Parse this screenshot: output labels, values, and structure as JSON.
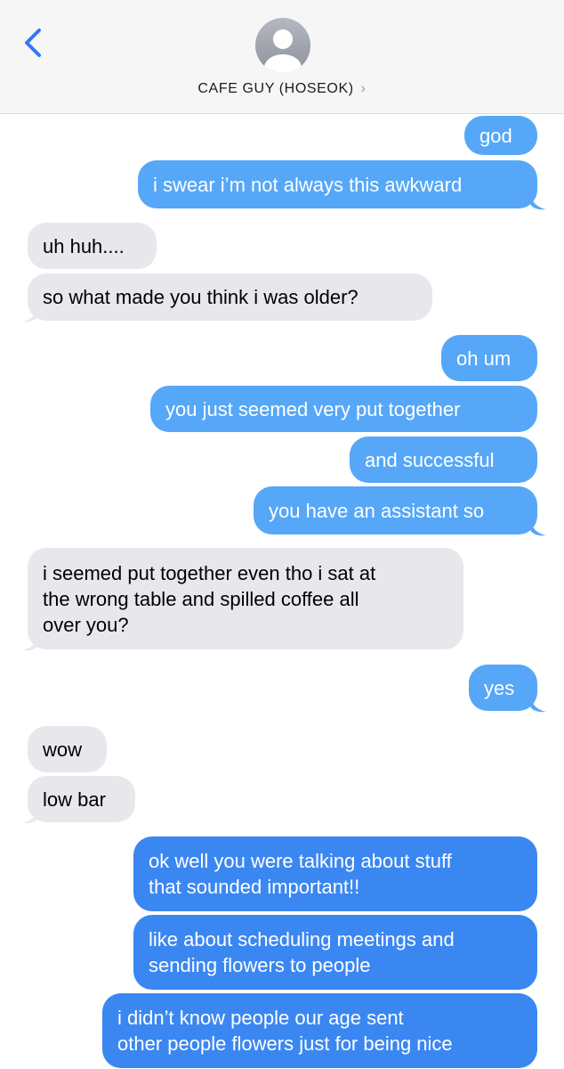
{
  "header": {
    "contact_name": "CAFE GUY (HOSEOK)",
    "chevron": "›",
    "back_icon": "chevron-left-icon",
    "avatar_icon": "person-silhouette-icon"
  },
  "colors": {
    "outgoing_light": "#56a7f7",
    "outgoing_deep": "#3b87f2",
    "incoming": "#e8e8ec",
    "ios_blue": "#3478f6"
  },
  "messages": [
    {
      "from": "me",
      "text": "god"
    },
    {
      "from": "me",
      "text": "i swear i’m not always this awkward"
    },
    {
      "from": "them",
      "text": "uh huh...."
    },
    {
      "from": "them",
      "text": "so what made you think i was older?"
    },
    {
      "from": "me",
      "text": "oh um"
    },
    {
      "from": "me",
      "text": "you just seemed very put together"
    },
    {
      "from": "me",
      "text": "and successful"
    },
    {
      "from": "me",
      "text": "you have an assistant so"
    },
    {
      "from": "them",
      "text": "i seemed put together even tho i sat at\nthe wrong table and spilled coffee all\nover you?"
    },
    {
      "from": "me",
      "text": "yes"
    },
    {
      "from": "them",
      "text": "wow"
    },
    {
      "from": "them",
      "text": "low bar"
    },
    {
      "from": "me",
      "text": "ok well you were talking about stuff\nthat sounded important!!"
    },
    {
      "from": "me",
      "text": "like about scheduling meetings and\nsending flowers to people"
    },
    {
      "from": "me",
      "text": "i didn’t know people our age sent\nother people flowers just for being nice"
    }
  ]
}
